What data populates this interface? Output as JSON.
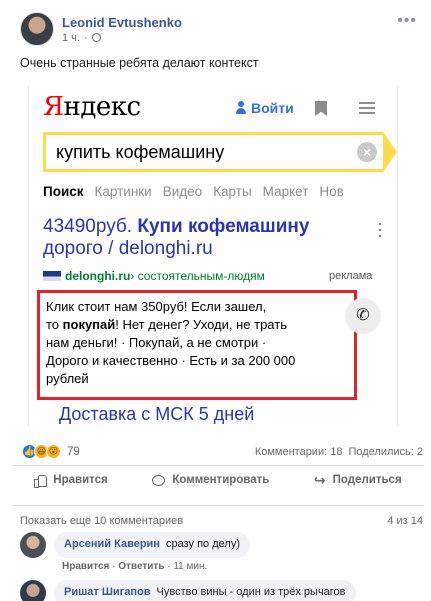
{
  "post": {
    "author": "Leonid Evtushenko",
    "time": "1 ч.",
    "separator": "·",
    "more": "•••",
    "text": "Очень странные ребята делают контекст"
  },
  "screenshot": {
    "logo_first": "Я",
    "logo_rest": "ндекс",
    "login": "Войти",
    "search_query": "купить кофемашину",
    "clear": "×",
    "tabs": [
      "Поиск",
      "Картинки",
      "Видео",
      "Карты",
      "Маркет",
      "Нов"
    ],
    "ad": {
      "title_price": "43490руб.",
      "title_main": "Купи кофемашину",
      "title_line2": "дорого / delonghi.ru",
      "domain": "delonghi.ru",
      "breadcrumb": " › состоятельным-людям",
      "label": "реклама",
      "body_1": "Клик стоит нам 350руб! Если зашел,",
      "body_2a": "то ",
      "body_2b": "покупай",
      "body_2c": "! Нет денег? Уходи, не трать",
      "body_3": "нам деньги! · Покупай, а не смотри ·",
      "body_4": "Дорого и качественно · Есть и за 200 000",
      "body_5": "рублей",
      "phone": "✆",
      "delivery": "Доставка с МСК 5 дней"
    }
  },
  "reactions": {
    "count": "79",
    "comments": "Комментарии: 18",
    "shares": "Поделились: 2"
  },
  "actions": {
    "like": "Нравится",
    "comment": "Комментировать",
    "share": "Поделиться"
  },
  "comments_section": {
    "show_more": "Показать ещё 10 комментариев",
    "counter": "4 из 14",
    "items": [
      {
        "name": "Арсений Каверин",
        "text": "сразу по делу)"
      },
      {
        "name": "Ришат Шигапов",
        "text": "Чувство вины - один из трёх рычагов"
      }
    ],
    "links": {
      "like": "Нравится",
      "reply": "Ответить",
      "time": "11 мин.",
      "dot": " · "
    }
  },
  "colors": {
    "facebook_link": "#385898",
    "yandex_red": "#ff0000",
    "yandex_yellow": "#ffdb4d",
    "ad_title": "#2a36b1",
    "ad_url": "#007c2f",
    "highlight_border": "#e0232c"
  }
}
